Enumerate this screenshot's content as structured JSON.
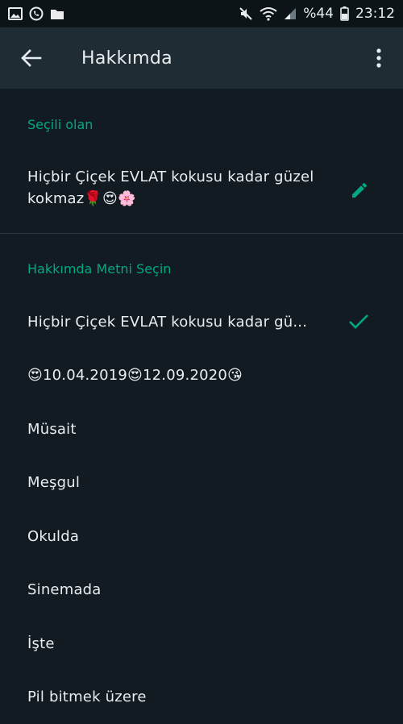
{
  "status_bar": {
    "battery_percent": "%44",
    "time": "23:12"
  },
  "app_bar": {
    "title": "Hakkımda"
  },
  "current": {
    "section_label": "Seçili olan",
    "text": "Hiçbir Çiçek EVLAT kokusu kadar güzel kokmaz🌹😍🌸"
  },
  "options_section": {
    "label": "Hakkımda Metni Seçin",
    "items": [
      {
        "label": "Hiçbir Çiçek EVLAT kokusu kadar gü...",
        "selected": true
      },
      {
        "label": "😍10.04.2019😍12.09.2020😘",
        "selected": false
      },
      {
        "label": "Müsait",
        "selected": false
      },
      {
        "label": "Meşgul",
        "selected": false
      },
      {
        "label": "Okulda",
        "selected": false
      },
      {
        "label": "Sinemada",
        "selected": false
      },
      {
        "label": "İşte",
        "selected": false
      },
      {
        "label": "Pil bitmek üzere",
        "selected": false
      }
    ]
  },
  "icons": {
    "back": "arrow-back-icon",
    "menu": "more-vert-icon",
    "edit": "pencil-icon",
    "check": "check-icon"
  },
  "colors": {
    "accent": "#00a884",
    "background": "#121b22",
    "app_bar": "#1f2c34"
  }
}
